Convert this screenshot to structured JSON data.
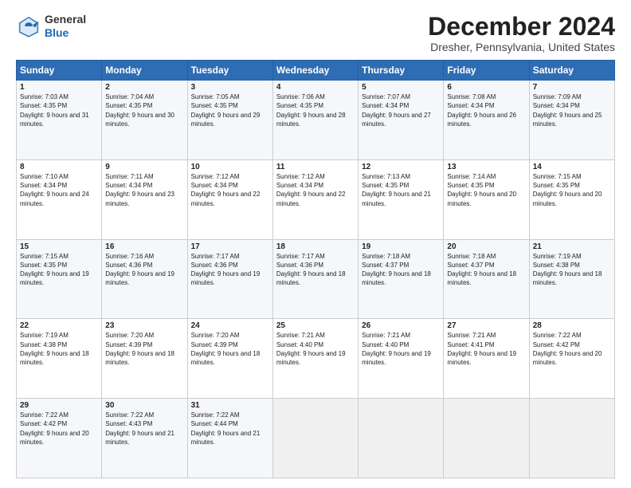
{
  "logo": {
    "general": "General",
    "blue": "Blue"
  },
  "title": "December 2024",
  "location": "Dresher, Pennsylvania, United States",
  "headers": [
    "Sunday",
    "Monday",
    "Tuesday",
    "Wednesday",
    "Thursday",
    "Friday",
    "Saturday"
  ],
  "weeks": [
    [
      {
        "day": "1",
        "sunrise": "7:03 AM",
        "sunset": "4:35 PM",
        "daylight": "9 hours and 31 minutes."
      },
      {
        "day": "2",
        "sunrise": "7:04 AM",
        "sunset": "4:35 PM",
        "daylight": "9 hours and 30 minutes."
      },
      {
        "day": "3",
        "sunrise": "7:05 AM",
        "sunset": "4:35 PM",
        "daylight": "9 hours and 29 minutes."
      },
      {
        "day": "4",
        "sunrise": "7:06 AM",
        "sunset": "4:35 PM",
        "daylight": "9 hours and 28 minutes."
      },
      {
        "day": "5",
        "sunrise": "7:07 AM",
        "sunset": "4:34 PM",
        "daylight": "9 hours and 27 minutes."
      },
      {
        "day": "6",
        "sunrise": "7:08 AM",
        "sunset": "4:34 PM",
        "daylight": "9 hours and 26 minutes."
      },
      {
        "day": "7",
        "sunrise": "7:09 AM",
        "sunset": "4:34 PM",
        "daylight": "9 hours and 25 minutes."
      }
    ],
    [
      {
        "day": "8",
        "sunrise": "7:10 AM",
        "sunset": "4:34 PM",
        "daylight": "9 hours and 24 minutes."
      },
      {
        "day": "9",
        "sunrise": "7:11 AM",
        "sunset": "4:34 PM",
        "daylight": "9 hours and 23 minutes."
      },
      {
        "day": "10",
        "sunrise": "7:12 AM",
        "sunset": "4:34 PM",
        "daylight": "9 hours and 22 minutes."
      },
      {
        "day": "11",
        "sunrise": "7:12 AM",
        "sunset": "4:34 PM",
        "daylight": "9 hours and 22 minutes."
      },
      {
        "day": "12",
        "sunrise": "7:13 AM",
        "sunset": "4:35 PM",
        "daylight": "9 hours and 21 minutes."
      },
      {
        "day": "13",
        "sunrise": "7:14 AM",
        "sunset": "4:35 PM",
        "daylight": "9 hours and 20 minutes."
      },
      {
        "day": "14",
        "sunrise": "7:15 AM",
        "sunset": "4:35 PM",
        "daylight": "9 hours and 20 minutes."
      }
    ],
    [
      {
        "day": "15",
        "sunrise": "7:15 AM",
        "sunset": "4:35 PM",
        "daylight": "9 hours and 19 minutes."
      },
      {
        "day": "16",
        "sunrise": "7:16 AM",
        "sunset": "4:36 PM",
        "daylight": "9 hours and 19 minutes."
      },
      {
        "day": "17",
        "sunrise": "7:17 AM",
        "sunset": "4:36 PM",
        "daylight": "9 hours and 19 minutes."
      },
      {
        "day": "18",
        "sunrise": "7:17 AM",
        "sunset": "4:36 PM",
        "daylight": "9 hours and 18 minutes."
      },
      {
        "day": "19",
        "sunrise": "7:18 AM",
        "sunset": "4:37 PM",
        "daylight": "9 hours and 18 minutes."
      },
      {
        "day": "20",
        "sunrise": "7:18 AM",
        "sunset": "4:37 PM",
        "daylight": "9 hours and 18 minutes."
      },
      {
        "day": "21",
        "sunrise": "7:19 AM",
        "sunset": "4:38 PM",
        "daylight": "9 hours and 18 minutes."
      }
    ],
    [
      {
        "day": "22",
        "sunrise": "7:19 AM",
        "sunset": "4:38 PM",
        "daylight": "9 hours and 18 minutes."
      },
      {
        "day": "23",
        "sunrise": "7:20 AM",
        "sunset": "4:39 PM",
        "daylight": "9 hours and 18 minutes."
      },
      {
        "day": "24",
        "sunrise": "7:20 AM",
        "sunset": "4:39 PM",
        "daylight": "9 hours and 18 minutes."
      },
      {
        "day": "25",
        "sunrise": "7:21 AM",
        "sunset": "4:40 PM",
        "daylight": "9 hours and 19 minutes."
      },
      {
        "day": "26",
        "sunrise": "7:21 AM",
        "sunset": "4:40 PM",
        "daylight": "9 hours and 19 minutes."
      },
      {
        "day": "27",
        "sunrise": "7:21 AM",
        "sunset": "4:41 PM",
        "daylight": "9 hours and 19 minutes."
      },
      {
        "day": "28",
        "sunrise": "7:22 AM",
        "sunset": "4:42 PM",
        "daylight": "9 hours and 20 minutes."
      }
    ],
    [
      {
        "day": "29",
        "sunrise": "7:22 AM",
        "sunset": "4:42 PM",
        "daylight": "9 hours and 20 minutes."
      },
      {
        "day": "30",
        "sunrise": "7:22 AM",
        "sunset": "4:43 PM",
        "daylight": "9 hours and 21 minutes."
      },
      {
        "day": "31",
        "sunrise": "7:22 AM",
        "sunset": "4:44 PM",
        "daylight": "9 hours and 21 minutes."
      },
      null,
      null,
      null,
      null
    ]
  ]
}
